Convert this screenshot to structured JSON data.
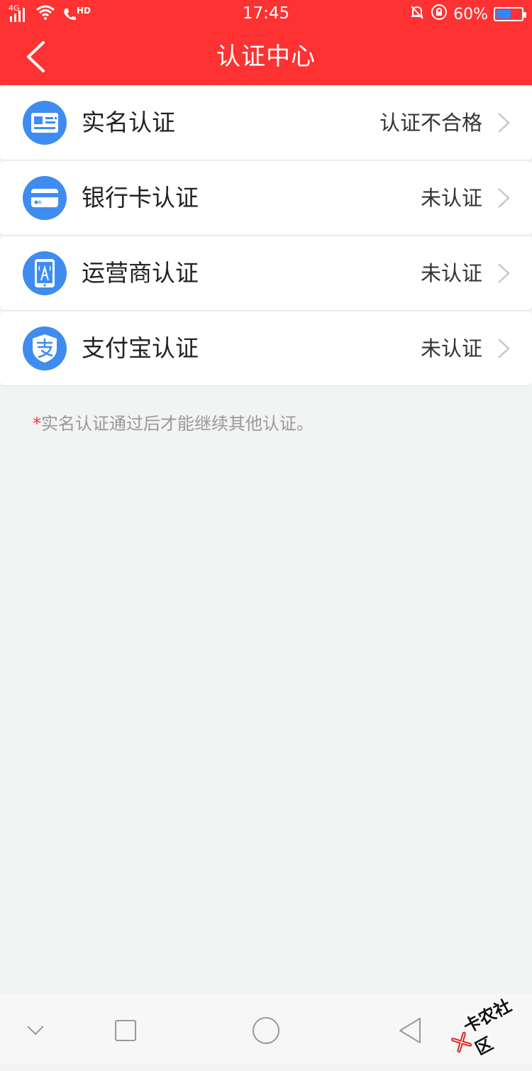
{
  "status_bar": {
    "network": "4G",
    "call": "HD",
    "time": "17:45",
    "battery": "60%",
    "battery_level": 0.6
  },
  "navbar": {
    "title": "认证中心"
  },
  "items": [
    {
      "label": "实名认证",
      "status": "认证不合格",
      "icon": "id-card-icon"
    },
    {
      "label": "银行卡认证",
      "status": "未认证",
      "icon": "bank-card-icon"
    },
    {
      "label": "运营商认证",
      "status": "未认证",
      "icon": "carrier-phone-icon"
    },
    {
      "label": "支付宝认证",
      "status": "未认证",
      "icon": "alipay-shield-icon"
    }
  ],
  "note": {
    "star": "*",
    "text": "实名认证通过后才能继续其他认证。"
  },
  "watermark": {
    "text": "卡农社区"
  },
  "colors": {
    "brand_red": "#fe3232",
    "icon_blue": "#3f8cf0",
    "background": "#f2f3f3"
  }
}
